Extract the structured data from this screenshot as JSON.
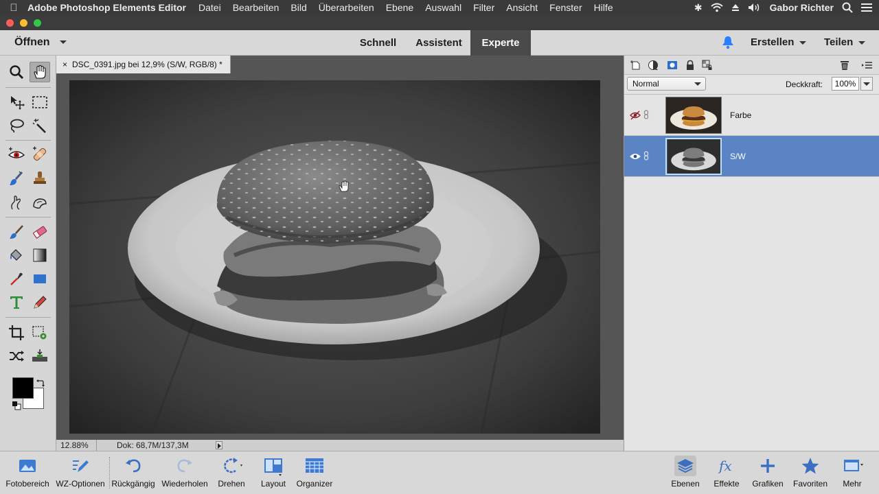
{
  "menubar": {
    "app_name": "Adobe Photoshop Elements Editor",
    "items": [
      "Datei",
      "Bearbeiten",
      "Bild",
      "Überarbeiten",
      "Ebene",
      "Auswahl",
      "Filter",
      "Ansicht",
      "Fenster",
      "Hilfe"
    ],
    "user": "Gabor Richter",
    "status_icons": [
      "bluetooth-icon",
      "wifi-icon",
      "eject-icon",
      "volume-icon",
      "search-icon",
      "list-icon"
    ]
  },
  "appbar": {
    "open_label": "Öffnen",
    "modes": [
      "Schnell",
      "Assistent",
      "Experte"
    ],
    "active_mode": "Experte",
    "create_label": "Erstellen",
    "share_label": "Teilen"
  },
  "document": {
    "tab_title": "DSC_0391.jpg bei 12,9% (S/W, RGB/8) *",
    "close_glyph": "×",
    "zoom": "12.88%",
    "doc_info": "Dok: 68,7M/137,3M"
  },
  "tools": [
    "zoom-tool",
    "hand-tool",
    "move-tool",
    "marquee-tool",
    "lasso-tool",
    "magic-wand-tool",
    "red-eye-tool",
    "spot-healing-tool",
    "smart-brush-tool",
    "clone-stamp-tool",
    "blur-tool",
    "smudge-tool",
    "brush-tool",
    "eraser-tool",
    "paint-bucket-tool",
    "gradient-tool",
    "eyedropper-tool",
    "shape-tool",
    "text-tool",
    "pencil-tool",
    "crop-tool",
    "recompose-tool",
    "content-aware-move-tool",
    "straighten-tool"
  ],
  "layers_panel": {
    "blend_mode": "Normal",
    "opacity_label": "Deckkraft:",
    "opacity_value": "100%",
    "layers": [
      {
        "name": "Farbe",
        "visible": false,
        "selected": false
      },
      {
        "name": "S/W",
        "visible": true,
        "selected": true
      }
    ]
  },
  "bottombar": {
    "left": [
      "Fotobereich",
      "WZ-Optionen",
      "Rückgängig",
      "Wiederholen",
      "Drehen",
      "Layout",
      "Organizer"
    ],
    "right": [
      "Ebenen",
      "Effekte",
      "Grafiken",
      "Favoriten",
      "Mehr"
    ]
  },
  "colors": {
    "accent_selected": "#5b84c4",
    "undo_blue": "#3a6fc2",
    "notification_blue": "#2a7fff"
  }
}
